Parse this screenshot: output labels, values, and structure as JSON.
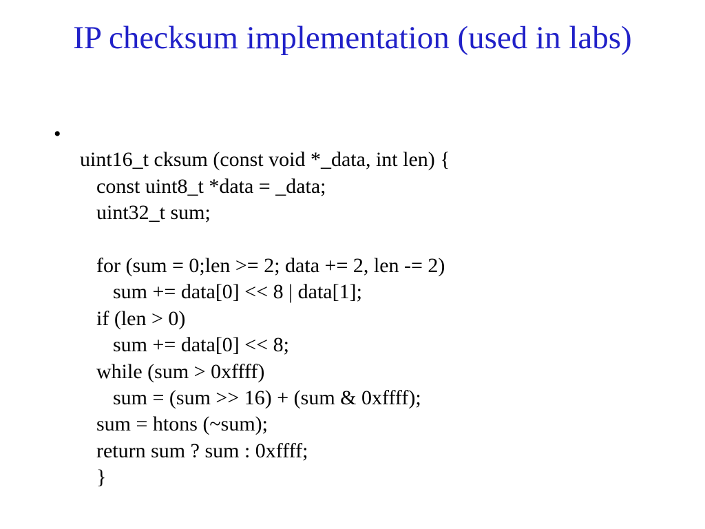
{
  "title": "IP checksum implementation (used in labs)",
  "code": {
    "l0": "uint16_t cksum (const void *_data, int len) {",
    "l1": "const uint8_t *data = _data;",
    "l2": "uint32_t sum;",
    "l3": "",
    "l4": "for (sum = 0;len >= 2; data += 2, len -= 2)",
    "l5": "sum += data[0] << 8 | data[1];",
    "l6": "if (len > 0)",
    "l7": "sum += data[0] << 8;",
    "l8": "while (sum > 0xffff)",
    "l9": "sum = (sum >> 16) + (sum & 0xffff);",
    "l10": "sum = htons (~sum);",
    "l11": "return sum ? sum : 0xffff;",
    "l12": "}"
  }
}
